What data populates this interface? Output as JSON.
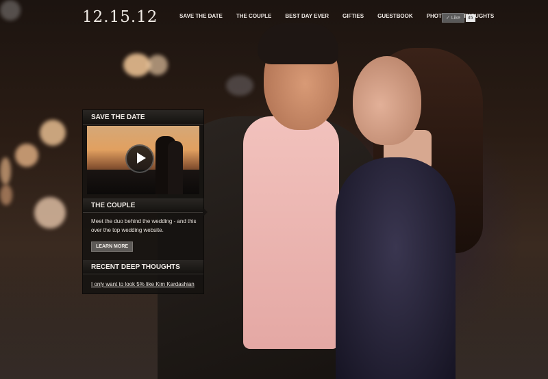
{
  "header": {
    "logo": "12.15.12",
    "nav": [
      "SAVE THE DATE",
      "THE COUPLE",
      "BEST DAY EVER",
      "GIFTIES",
      "GUESTBOOK",
      "PHOTOS",
      "THOUGHTS"
    ],
    "like": {
      "label": "Like",
      "count": "45"
    }
  },
  "panel": {
    "save_the_date": {
      "title": "SAVE THE DATE"
    },
    "the_couple": {
      "title": "THE COUPLE",
      "text": "Meet the duo behind the wedding - and this over the top wedding website.",
      "button": "LEARN MORE"
    },
    "recent": {
      "title": "RECENT DEEP THOUGHTS",
      "link": "I only want to look 5% like Kim Kardashian"
    }
  },
  "icons": {
    "play": "play-icon",
    "like": "thumbs-up-icon"
  }
}
